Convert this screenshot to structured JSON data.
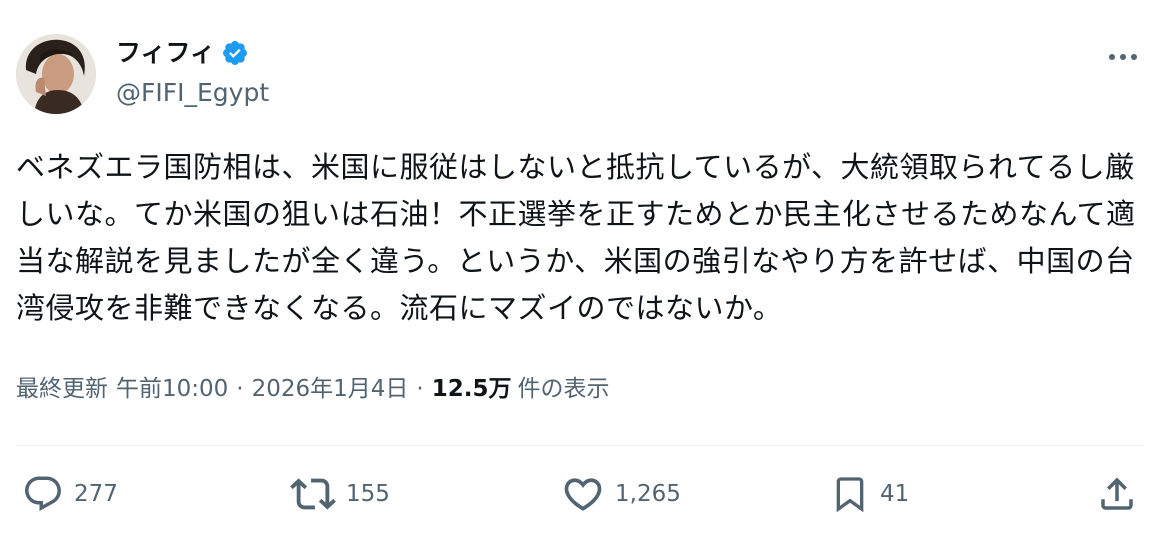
{
  "author": {
    "display_name": "フィフィ",
    "handle": "@FIFI_Egypt",
    "verified": true,
    "avatar_icon": "profile-photo",
    "verified_color": "#1d9bf0"
  },
  "tweet": {
    "text": "ベネズエラ国防相は、米国に服従はしないと抵抗しているが、大統領取られてるし厳しいな。てか米国の狙いは石油！不正選挙を正すためとか民主化させるためなんて適当な解説を見ましたが全く違う。というか、米国の強引なやり方を許せば、中国の台湾侵攻を非難できなくなる。流石にマズイのではないか。"
  },
  "meta": {
    "updated_label": "最終更新",
    "time": "午前10:00",
    "separator": "·",
    "date": "2026年1月4日",
    "views_count": "12.5万",
    "views_label": "件の表示"
  },
  "actions": {
    "replies": "277",
    "reposts": "155",
    "likes": "1,265",
    "bookmarks": "41",
    "icons": [
      "reply-icon",
      "repost-icon",
      "like-icon",
      "bookmark-icon",
      "share-icon"
    ]
  },
  "colors": {
    "text_primary": "#0f1419",
    "text_secondary": "#536471",
    "divider": "#eff3f4",
    "verified": "#1d9bf0"
  }
}
